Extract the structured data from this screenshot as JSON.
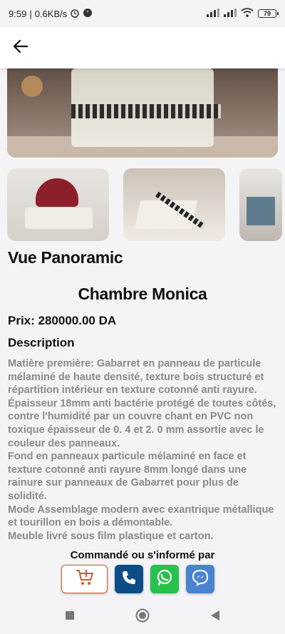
{
  "status_bar": {
    "time": "9:59",
    "speed": "0.6KB/s",
    "battery": "79"
  },
  "product": {
    "section_title": "Vue Panoramic",
    "name": "Chambre Monica",
    "price_label": "Prix: 280000.00 DA",
    "description_heading": "Description",
    "description": "Matière première: Gabarret en panneau de particule mélaminé de haute densité, texture bois structuré et répartition intérieur en texture cotonné anti rayure.\nÉpaisseur 18mm anti bactérie protégé de toutes côtés, contre l'humidité par un couvre chant en PVC non toxique épaisseur de 0. 4 et 2. 0 mm assortie avec le couleur des panneaux.\nFond en panneaux particule mélaminé en face et texture cotonné anti rayure 8mm longé dans une rainure sur panneaux de Gabarret pour plus de solidité.\nMode Assemblage modern avec exantrique métallique et tourillon en bois a démontable.\nMeuble livré sous film plastique et carton."
  },
  "order": {
    "label": "Commandé ou s'informé par"
  },
  "icons": {
    "back": "arrow-left-icon",
    "cart": "add-to-cart-icon",
    "phone": "phone-icon",
    "whatsapp": "whatsapp-icon",
    "messenger": "messenger-icon"
  },
  "colors": {
    "cart_accent": "#cf5b2c",
    "phone": "#0c4d86",
    "whatsapp": "#27c14d",
    "messenger": "#4a84d1"
  }
}
